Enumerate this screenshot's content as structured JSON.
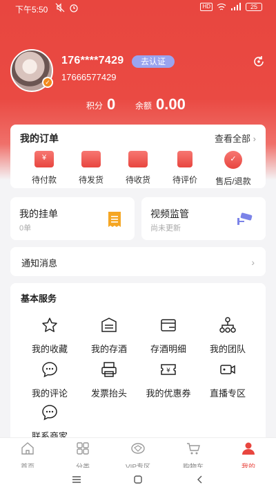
{
  "statusbar": {
    "time": "下午5:50",
    "battery": "25"
  },
  "profile": {
    "phone_masked": "176****7429",
    "verify_label": "去认证",
    "phone_full": "17666577429",
    "points_label": "积分",
    "points_value": "0",
    "balance_label": "余额",
    "balance_value": "0.00"
  },
  "orders": {
    "title": "我的订单",
    "view_all": "查看全部",
    "items": [
      {
        "label": "待付款",
        "glyph": "¥"
      },
      {
        "label": "待发货",
        "glyph": ""
      },
      {
        "label": "待收货",
        "glyph": ""
      },
      {
        "label": "待评价",
        "glyph": ""
      },
      {
        "label": "售后/退款",
        "glyph": "✓"
      }
    ]
  },
  "pending": {
    "title": "我的挂单",
    "subtitle": "0单"
  },
  "video": {
    "title": "视频监管",
    "subtitle": "尚未更新"
  },
  "notify": {
    "title": "通知消息"
  },
  "services": {
    "title": "基本服务",
    "items": [
      {
        "label": "我的收藏",
        "icon": "star-icon"
      },
      {
        "label": "我的存酒",
        "icon": "wine-storage-icon"
      },
      {
        "label": "存酒明细",
        "icon": "wallet-icon"
      },
      {
        "label": "我的团队",
        "icon": "team-icon"
      },
      {
        "label": "我的评论",
        "icon": "comment-icon"
      },
      {
        "label": "发票抬头",
        "icon": "invoice-icon"
      },
      {
        "label": "我的优惠券",
        "icon": "coupon-icon"
      },
      {
        "label": "直播专区",
        "icon": "video-icon"
      },
      {
        "label": "联系商家",
        "icon": "chat-icon"
      }
    ]
  },
  "tabs": [
    {
      "label": "首页",
      "icon": "home-icon"
    },
    {
      "label": "分类",
      "icon": "category-icon"
    },
    {
      "label": "VIP专区",
      "icon": "vip-icon"
    },
    {
      "label": "购物车",
      "icon": "cart-icon"
    },
    {
      "label": "我的",
      "icon": "profile-icon"
    }
  ],
  "colors": {
    "brand": "#e8463f",
    "verify": "#9aa4ef",
    "orange": "#f5a623"
  }
}
